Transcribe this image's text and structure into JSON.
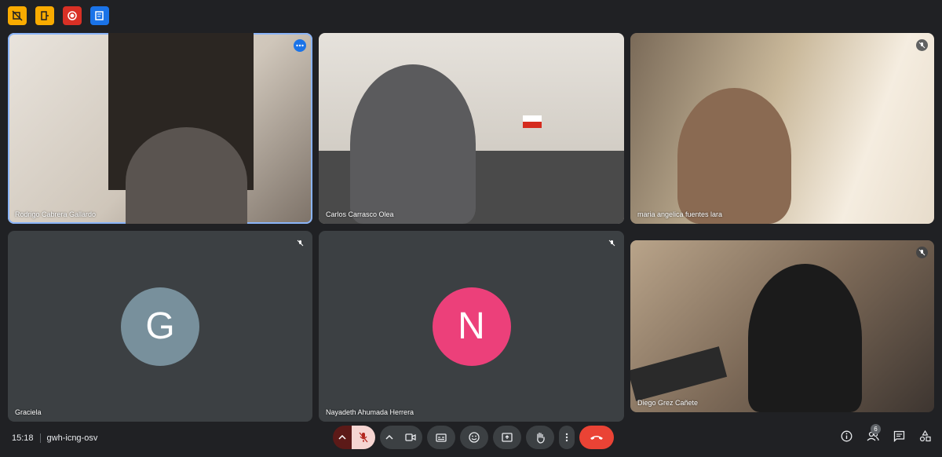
{
  "top_icons": [
    "no-video-icon",
    "exit-icon",
    "record-icon",
    "notes-icon"
  ],
  "participants": [
    {
      "name": "Rodrigo Cabrera Gallardo",
      "type": "video",
      "active": true
    },
    {
      "name": "Carlos Carrasco Olea",
      "type": "video"
    },
    {
      "name": "maria angelica fuentes lara",
      "type": "video",
      "muted": true
    },
    {
      "name": "Graciela",
      "type": "avatar",
      "initial": "G",
      "color": "#78909c",
      "muted": true
    },
    {
      "name": "Nayadeth Ahumada Herrera",
      "type": "avatar",
      "initial": "N",
      "color": "#ec407a",
      "muted": true
    },
    {
      "name": "Diego Grez Cañete",
      "type": "video",
      "muted": true
    }
  ],
  "bottom": {
    "time": "15:18",
    "meeting_code": "gwh-icng-osv",
    "people_count": "6"
  }
}
